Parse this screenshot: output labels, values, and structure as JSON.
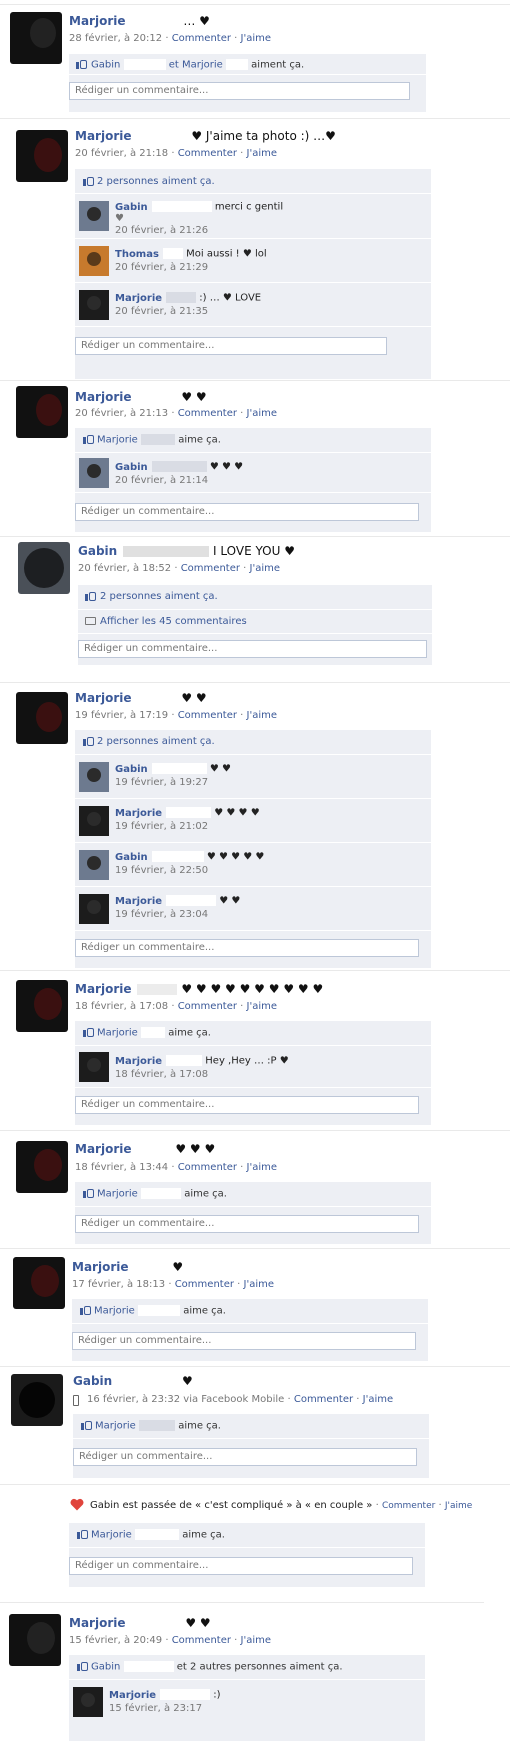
{
  "posts": [
    {
      "author": "Marjorie",
      "title_text": "… ♥",
      "date": "28 février, à 20:12",
      "like_line": {
        "prefix": "Gabin",
        "middle": "et Marjorie",
        "suffix": "aiment ça."
      },
      "comment_action": "Commenter",
      "like_action": "J'aime",
      "input_placeholder": "Rédiger un commentaire..."
    },
    {
      "author": "Marjorie",
      "title_text": "♥ J'aime ta photo :) …♥",
      "date": "20 février, à 21:18",
      "like_text": "2 personnes aiment ça.",
      "comments": [
        {
          "name": "Gabin",
          "text": "merci c gentil",
          "text2": "♥",
          "date": "20 février, à 21:26"
        },
        {
          "name": "Thomas",
          "text": "Moi aussi ! ♥ lol",
          "date": "20 février, à 21:29"
        },
        {
          "name": "Marjorie",
          "text": ":) … ♥ LOVE",
          "date": "20 février, à 21:35"
        }
      ]
    },
    {
      "author": "Marjorie",
      "title_text": "♥ ♥",
      "date": "20 février, à 21:13",
      "like_line": {
        "prefix": "Marjorie",
        "suffix": "aime ça."
      },
      "comments": [
        {
          "name": "Gabin",
          "text": "♥ ♥ ♥",
          "date": "20 février, à 21:14"
        }
      ]
    },
    {
      "author": "Gabin",
      "title_text": "I LOVE YOU ♥",
      "date": "20 février, à 18:52",
      "like_text": "2 personnes aiment ça.",
      "show_all": "Afficher les 45 commentaires"
    },
    {
      "author": "Marjorie",
      "title_text": "♥ ♥",
      "date": "19 février, à 17:19",
      "like_text": "2 personnes aiment ça.",
      "comments": [
        {
          "name": "Gabin",
          "text": "♥ ♥",
          "date": "19 février, à 19:27"
        },
        {
          "name": "Marjorie",
          "text": "♥ ♥ ♥ ♥",
          "date": "19 février, à 21:02"
        },
        {
          "name": "Gabin",
          "text": "♥ ♥ ♥ ♥ ♥",
          "date": "19 février, à 22:50"
        },
        {
          "name": "Marjorie",
          "text": "♥ ♥",
          "date": "19 février, à 23:04"
        }
      ]
    },
    {
      "author": "Marjorie",
      "title_text": "♥ ♥ ♥ ♥ ♥ ♥ ♥ ♥ ♥ ♥",
      "date": "18 février, à 17:08",
      "like_line": {
        "prefix": "Marjorie",
        "suffix": "aime ça."
      },
      "comments": [
        {
          "name": "Marjorie",
          "text": "Hey ,Hey … :P ♥",
          "date": "18 février, à 17:08"
        }
      ]
    },
    {
      "author": "Marjorie",
      "title_text": "♥ ♥ ♥",
      "date": "18 février, à 13:44",
      "like_line": {
        "prefix": "Marjorie",
        "suffix": "aime ça."
      }
    },
    {
      "author": "Marjorie",
      "title_text": "♥",
      "date": "17 février, à 18:13",
      "like_line": {
        "prefix": "Marjorie",
        "suffix": "aime ça."
      }
    },
    {
      "author": "Gabin",
      "title_text": "♥",
      "date": "16 février, à 23:32 via Facebook Mobile",
      "like_line": {
        "prefix": "Marjorie",
        "suffix": "aime ça."
      }
    },
    {
      "status_text": "Gabin est passée de « c'est compliqué » à « en couple »",
      "like_line": {
        "prefix": "Marjorie",
        "suffix": "aime ça."
      }
    },
    {
      "author": "Marjorie",
      "title_text": "♥ ♥",
      "date": "15 février, à 20:49",
      "like_line": {
        "prefix": "Gabin",
        "suffix": "et 2 autres personnes aiment ça."
      },
      "comments": [
        {
          "name": "Marjorie",
          "text": ":)",
          "date": "15 février, à 23:17"
        }
      ]
    }
  ],
  "common": {
    "comment_action": "Commenter",
    "like_action": "J'aime",
    "dot": "·",
    "input_placeholder": "Rédiger un commentaire..."
  },
  "colors": {
    "link": "#3b5998",
    "block_bg": "#edeff4",
    "heart": "#e0443c"
  }
}
